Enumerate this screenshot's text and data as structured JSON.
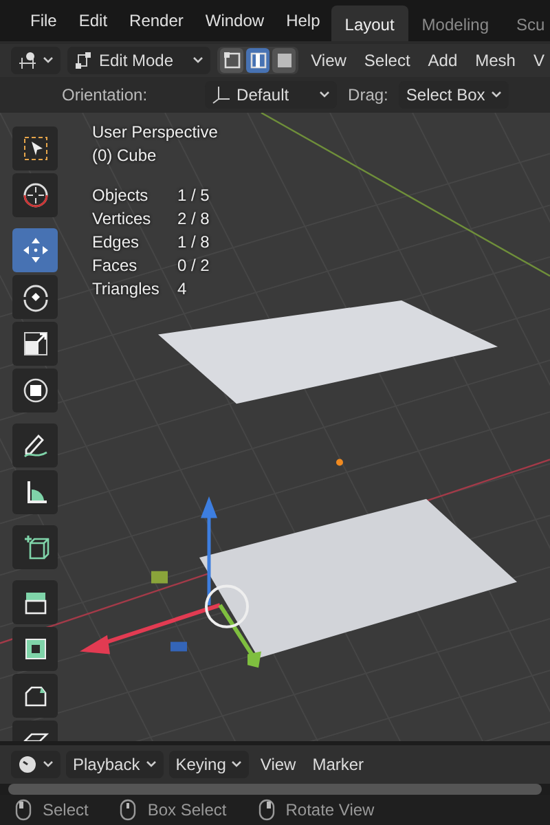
{
  "menu_bar": {
    "items": [
      "File",
      "Edit",
      "Render",
      "Window",
      "Help"
    ],
    "workspace_tabs": [
      {
        "label": "Layout",
        "selected": true
      },
      {
        "label": "Modeling",
        "selected": false
      },
      {
        "label": "Scu",
        "selected": false
      }
    ]
  },
  "header": {
    "mode": "Edit Mode",
    "select_modes": [
      {
        "kind": "vertex",
        "selected": false
      },
      {
        "kind": "edge",
        "selected": true
      },
      {
        "kind": "face",
        "selected": false
      }
    ],
    "menus": [
      "View",
      "Select",
      "Add",
      "Mesh",
      "V"
    ]
  },
  "tool_settings": {
    "orientation_label": "Orientation:",
    "orientation": "Default",
    "drag_label": "Drag:",
    "drag": "Select Box"
  },
  "toolbar": {
    "groups": [
      [
        {
          "kind": "select_box",
          "selected": false
        },
        {
          "kind": "cursor",
          "selected": false
        }
      ],
      [
        {
          "kind": "move",
          "selected": true
        },
        {
          "kind": "rotate",
          "selected": false
        },
        {
          "kind": "scale",
          "selected": false
        },
        {
          "kind": "transform",
          "selected": false
        }
      ],
      [
        {
          "kind": "annotate",
          "selected": false
        },
        {
          "kind": "measure",
          "selected": false
        }
      ],
      [
        {
          "kind": "add_cube",
          "selected": false
        }
      ],
      [
        {
          "kind": "extrude",
          "selected": false
        },
        {
          "kind": "inset",
          "selected": false
        },
        {
          "kind": "bevel",
          "selected": false
        },
        {
          "kind": "loop_cut",
          "selected": false
        }
      ]
    ]
  },
  "overlay": {
    "view": "User Perspective",
    "object": "(0) Cube",
    "stats": [
      {
        "label": "Objects",
        "value": "1 / 5"
      },
      {
        "label": "Vertices",
        "value": "2 / 8"
      },
      {
        "label": "Edges",
        "value": "1 / 8"
      },
      {
        "label": "Faces",
        "value": "0 / 2"
      },
      {
        "label": "Triangles",
        "value": "4"
      }
    ]
  },
  "timeline": {
    "menus": [
      {
        "label": "Playback",
        "kind": "dropdown"
      },
      {
        "label": "Keying",
        "kind": "dropdown"
      },
      {
        "label": "View",
        "kind": "menu"
      },
      {
        "label": "Marker",
        "kind": "menu"
      }
    ]
  },
  "status_bar": [
    {
      "kind": "left",
      "label": "Select"
    },
    {
      "kind": "middle",
      "label": "Box Select"
    },
    {
      "kind": "right",
      "label": "Rotate View"
    }
  ]
}
